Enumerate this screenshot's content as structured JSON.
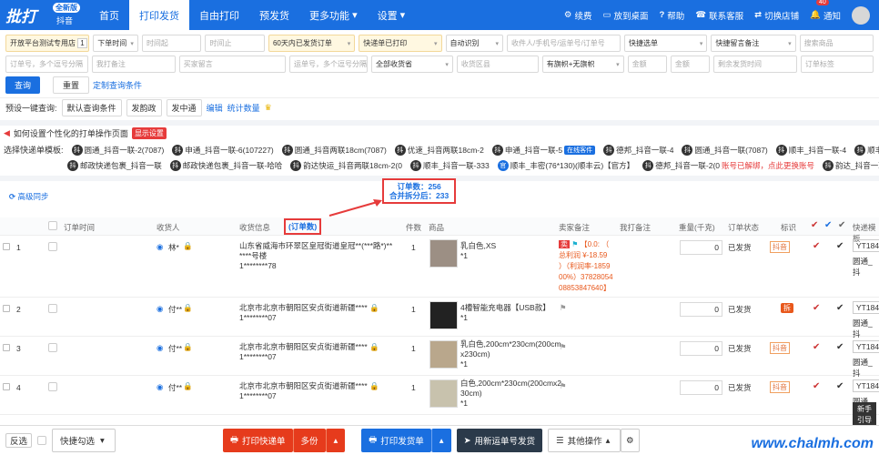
{
  "nav": {
    "logo": "批打",
    "logo_badge": "全新版",
    "logo_sub": "抖音",
    "tabs": [
      "首页",
      "打印发货",
      "自由打印",
      "预发货",
      "更多功能",
      "设置"
    ],
    "right": [
      "续费",
      "放到桌面",
      "帮助",
      "联系客服",
      "切换店铺",
      "通知"
    ],
    "notif_count": "40"
  },
  "filters": {
    "row1": [
      "开放平台测试专用店",
      "1",
      "下单时间",
      "时间起",
      "时间止",
      "60天内已发货订单",
      "快递单已打印",
      "自动识别",
      "收件人/手机号/运单号/订单号",
      "快捷选单",
      "快捷留言备注",
      "搜索商品"
    ],
    "row2": [
      "订单号，多个逗号分隔",
      "我打备注",
      "买家留言",
      "运单号，多个逗号分隔",
      "全部收货省",
      "收货区县",
      "有旗帜+无旗帜",
      "金额",
      "金额",
      "剩余发货时间",
      "订单标签"
    ],
    "query": "查询",
    "reset": "重置",
    "custom": "定制查询条件"
  },
  "presets": {
    "label": "预设一键查询:",
    "items": [
      "默认查询条件",
      "发韵政",
      "发中通"
    ],
    "edit": "编辑",
    "stats": "统计数量"
  },
  "tip": {
    "text": "如何设置个性化的打单操作页面",
    "badge": "显示设置"
  },
  "templates": {
    "label": "选择快递单模板:",
    "row1": [
      "圆通_抖音一联-2(7087)",
      "申通_抖音一联-6(107227)",
      "圆通_抖音两联18cm(7087)",
      "优速_抖音两联18cm-2",
      "申通_抖音一联-5",
      "德邦_抖音一联-4",
      "圆通_抖音一联(7087)",
      "顺丰_抖音一联-4",
      "顺丰"
    ],
    "row1_tag": "在线客件",
    "row2": [
      "邮政快递包裹_抖音一联",
      "邮政快递包裹_抖音一联-哈哈",
      "韵达快运_抖音两联18cm-2(0",
      "顺丰_抖音一联-333",
      "顺丰_丰密(76*130)(顺丰云)【官方】",
      "德邦_抖音一联-2(0",
      "韵达_抖音一联-2(0"
    ],
    "row2_warn": "账号已解绑，点此更换账号"
  },
  "sync": "高级同步",
  "callout": {
    "line1": "订单数：256",
    "line2": "合并拆分后：233"
  },
  "table": {
    "headers": [
      "订单时间",
      "收货人",
      "收货信息",
      "(订单数)",
      "件数",
      "商品",
      "卖家备注",
      "我打备注",
      "重量(千克)",
      "订单状态",
      "标识",
      "快递模板"
    ],
    "rows": [
      {
        "no": "1",
        "name": "林*",
        "addr1": "山东省威海市环翠区皇冠街道皇冠**(***路*)**",
        "addr2": "****号楼",
        "phone": "1********78",
        "qty": "1",
        "prod": "乳白色,XS",
        "prod_n": "*1",
        "remark": [
          "【0.0: （",
          "总利润 ¥-18.59",
          "）（利润率-1859",
          "00%）37828054",
          "08853847640】"
        ],
        "weight": "0",
        "status": "已发货",
        "tag": "抖音",
        "tracking": "YT184",
        "tpl": "圆通_抖"
      },
      {
        "no": "2",
        "name": "付**",
        "addr1": "北京市北京市朝阳区安贞街道新疆****",
        "addr2": "",
        "phone": "1********07",
        "qty": "1",
        "prod": "4槽智能充电器【USB款】",
        "prod_n": "*1",
        "remark": [],
        "weight": "0",
        "status": "已发货",
        "tag": "拆",
        "tracking": "YT184",
        "tpl": "圆通_抖"
      },
      {
        "no": "3",
        "name": "付**",
        "addr1": "北京市北京市朝阳区安贞街道新疆****",
        "addr2": "",
        "phone": "1********07",
        "qty": "1",
        "prod": "乳白色,200cm*230cm(200cm",
        "prod2": "x230cm)",
        "prod_n": "*1",
        "remark": [],
        "weight": "0",
        "status": "已发货",
        "tag": "抖音",
        "tracking": "YT184",
        "tpl": "圆通_抖"
      },
      {
        "no": "4",
        "name": "付**",
        "addr1": "北京市北京市朝阳区安贞街道新疆****",
        "addr2": "",
        "phone": "1********07",
        "qty": "1",
        "prod": "白色,200cm*230cm(200cmx2",
        "prod2": "30cm)",
        "prod_n": "*1",
        "remark": [],
        "weight": "0",
        "status": "已发货",
        "tag": "抖音",
        "tracking": "YT184",
        "tpl": "圆通_抖"
      }
    ],
    "remark_flag": "卖"
  },
  "bottom": {
    "invert": "反选",
    "quick": "快捷勾选",
    "print_express": "打印快递单",
    "multi": "多份",
    "print_ship": "打印发货单",
    "new_waybill": "用新运单号发货",
    "other": "其他操作"
  },
  "help": [
    "新手",
    "引导"
  ],
  "watermark": "www.chalmh.com"
}
